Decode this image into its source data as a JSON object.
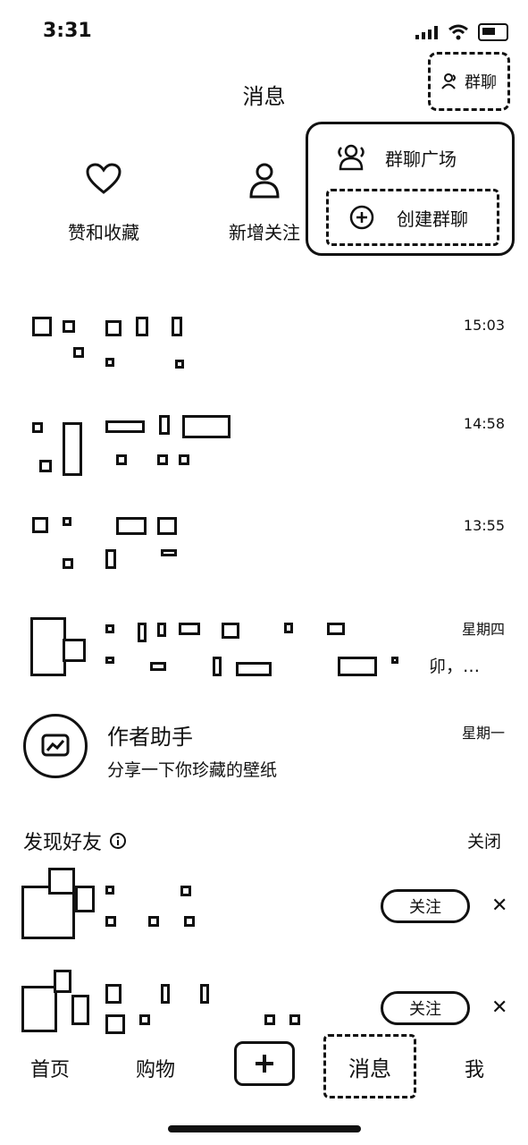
{
  "status_bar": {
    "time": "3:31"
  },
  "header": {
    "title": "消息",
    "group_chat_label": "群聊"
  },
  "shortcuts": [
    {
      "label": "赞和收藏",
      "icon": "heart-icon"
    },
    {
      "label": "新增关注",
      "icon": "person-icon"
    }
  ],
  "popup": {
    "items": [
      {
        "label": "群聊广场",
        "icon": "group-icon"
      },
      {
        "label": "创建群聊",
        "icon": "plus-circle-icon"
      }
    ]
  },
  "chats": [
    {
      "time": "15:03"
    },
    {
      "time": "14:58"
    },
    {
      "time": "13:55"
    },
    {
      "time": "星期四",
      "preview_tail": "卯，…"
    }
  ],
  "assistant": {
    "name": "作者助手",
    "preview": "分享一下你珍藏的壁纸",
    "time": "星期一"
  },
  "discover": {
    "title": "发现好友",
    "close_label": "关闭",
    "follow_label": "关注",
    "dismiss_symbol": "✕"
  },
  "bottom_nav": {
    "home": "首页",
    "shop": "购物",
    "messages": "消息",
    "me": "我"
  }
}
